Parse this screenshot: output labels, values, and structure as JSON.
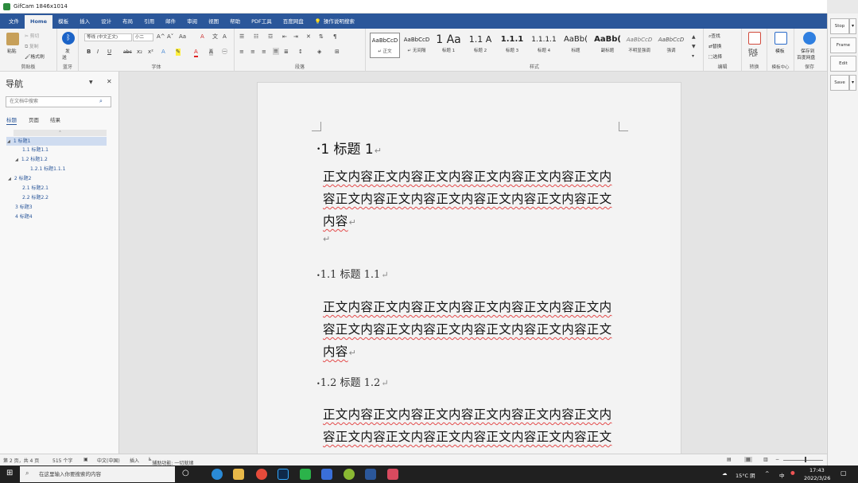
{
  "window": {
    "title": "GifCam 1846x1014"
  },
  "ribbon_tabs": [
    "文件",
    "Home",
    "模板",
    "插入",
    "设计",
    "布局",
    "引用",
    "邮件",
    "审阅",
    "视图",
    "帮助",
    "PDF工具",
    "百度网盘",
    "操作说明搜索"
  ],
  "clipboard": {
    "paste": "粘贴",
    "cut": "剪切",
    "copy": "复制",
    "format_painter": "格式刷",
    "label": "剪贴板"
  },
  "bluetooth": {
    "label1": "发",
    "label2": "送",
    "group": "蓝牙"
  },
  "font": {
    "name": "等线 (中文正文)",
    "size": "小二",
    "label": "字体",
    "bold": "B",
    "italic": "I",
    "underline": "U",
    "strike": "abc",
    "sub": "x₂",
    "sup": "x²",
    "grow": "A^",
    "shrink": "A˅",
    "case": "Aa",
    "clear": "A"
  },
  "paragraph": {
    "label": "段落"
  },
  "styles": {
    "label": "样式",
    "items": [
      {
        "sample": "AaBbCcD",
        "name": "↵ 正文"
      },
      {
        "sample": "AaBbCcD",
        "name": "↵ 无间隔"
      },
      {
        "sample": "1  Aa",
        "name": "标题 1"
      },
      {
        "sample": "1.1  A",
        "name": "标题 2"
      },
      {
        "sample": "1.1.1",
        "name": "标题 3"
      },
      {
        "sample": "1.1.1.1",
        "name": "标题 4"
      },
      {
        "sample": "AaBb(",
        "name": "标题"
      },
      {
        "sample": "AaBb(",
        "name": "副标题"
      },
      {
        "sample": "AaBbCcD",
        "name": "不明显强调"
      },
      {
        "sample": "AaBbCcD",
        "name": "强调"
      }
    ]
  },
  "editing": {
    "find": "查找",
    "replace": "替换",
    "select": "选择",
    "label": "编辑"
  },
  "convert": {
    "line1": "转成",
    "line2": "PDF",
    "label": "转换"
  },
  "templates": {
    "line1": "模板",
    "label": "模板中心"
  },
  "save_cloud": {
    "line1": "保存到",
    "line2": "百度网盘",
    "label": "保存"
  },
  "nav": {
    "title": "导航",
    "search_placeholder": "在文档中搜索",
    "tabs": [
      "标题",
      "页面",
      "结果"
    ],
    "tree": [
      {
        "text": "1 标题1"
      },
      {
        "text": "1.1 标题1.1"
      },
      {
        "text": "1.2 标题1.2"
      },
      {
        "text": "1.2.1 标题1.1.1"
      },
      {
        "text": "2 标题2"
      },
      {
        "text": "2.1 标题2.1"
      },
      {
        "text": "2.2 标题2.2"
      },
      {
        "text": "3 标题3"
      },
      {
        "text": "4 标题4"
      }
    ]
  },
  "document": {
    "h1": "1  标题 1",
    "p1": [
      "正文内容正文内容正文内容正文内容正文内容正文内",
      "容正文内容正文内容正文内容正文内容正文内容正文",
      "内容"
    ],
    "h2a": "1.1  标题 1.1",
    "p2": [
      "正文内容正文内容正文内容正文内容正文内容正文内",
      "容正文内容正文内容正文内容正文内容正文内容正文",
      "内容"
    ],
    "h2b": "1.2  标题 1.2",
    "p3": [
      "正文内容正文内容正文内容正文内容正文内容正文内",
      "容正文内容正文内容正文内容正文内容正文内容正文"
    ],
    "return_mark": "↵"
  },
  "gifcam": {
    "stop": "Stop",
    "frame": "Frame",
    "edit": "Edit",
    "save": "Save"
  },
  "status": {
    "page": "第 2 页，共 4 页",
    "words": "515 个字",
    "lang": "中文(中国)",
    "mode": "插入",
    "accessibility": "辅助功能: 一切就绪"
  },
  "taskbar": {
    "search_placeholder": "在这里输入你要搜索的内容",
    "weather": "15°C 阴",
    "ime": "中",
    "time": "17:43",
    "date": "2022/3/26"
  },
  "colors": {
    "ribbon_blue": "#2b579a",
    "squiggle_red": "#e34a4a"
  }
}
